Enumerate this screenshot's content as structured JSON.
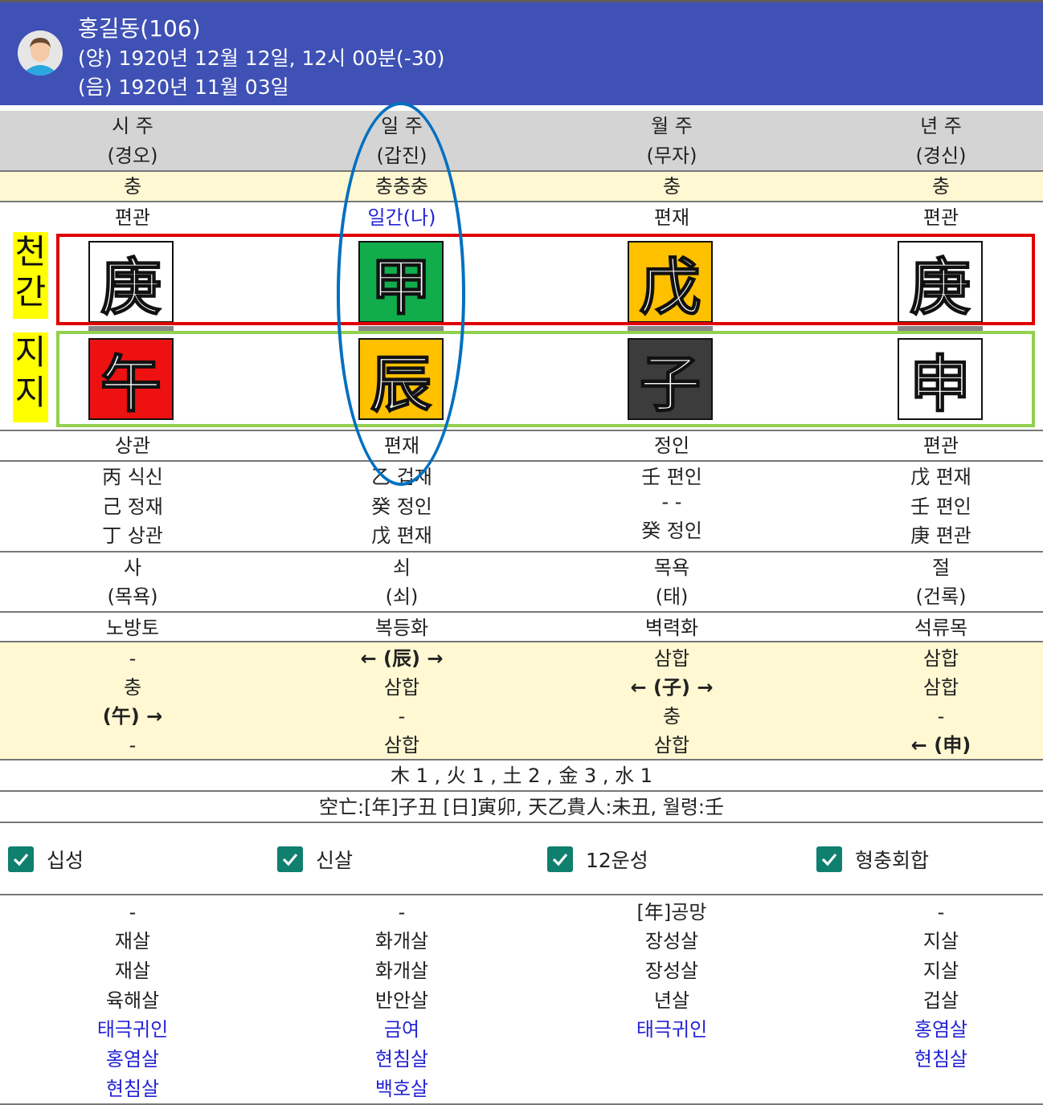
{
  "header": {
    "name": "홍길동(106)",
    "solar": "(양) 1920년 12월 12일, 12시 00분(-30)",
    "lunar": "(음) 1920년 11월 03일"
  },
  "pillars": {
    "titles": [
      "시 주",
      "일 주",
      "월 주",
      "년 주"
    ],
    "subtitles": [
      "(경오)",
      "(갑진)",
      "(무자)",
      "(경신)"
    ],
    "clash": [
      "충",
      "충충충",
      "충",
      "충"
    ],
    "stem_gods": [
      "편관",
      "일간(나)",
      "편재",
      "편관"
    ],
    "stems": [
      "庚",
      "甲",
      "戊",
      "庚"
    ],
    "branches": [
      "午",
      "辰",
      "子",
      "申"
    ],
    "branch_gods": [
      "상관",
      "편재",
      "정인",
      "편관"
    ],
    "hidden": [
      [
        "丙 식신",
        "己 정재",
        "丁 상관"
      ],
      [
        "乙 겁재",
        "癸 정인",
        "戊 편재"
      ],
      [
        "壬 편인",
        "- -",
        "癸 정인"
      ],
      [
        "戊 편재",
        "壬 편인",
        "庚 편관"
      ]
    ],
    "twelve_stage": [
      "사",
      "쇠",
      "목욕",
      "절"
    ],
    "twelve_stage_sub": [
      "(목욕)",
      "(쇠)",
      "(태)",
      "(건록)"
    ],
    "napeum": [
      "노방토",
      "복등화",
      "벽력화",
      "석류목"
    ],
    "relations": [
      [
        "-",
        "충",
        "(午) →",
        "-"
      ],
      [
        "← (辰) →",
        "삼합",
        "-",
        "삼합"
      ],
      [
        "삼합",
        "← (子) →",
        "충",
        "삼합"
      ],
      [
        "삼합",
        "삼합",
        "-",
        "← (申)"
      ]
    ]
  },
  "side_labels": {
    "stem": [
      "천",
      "간"
    ],
    "branch": [
      "지",
      "지"
    ]
  },
  "elements_summary": "木 1 , 火 1 , 土 2 , 金 3 , 水 1",
  "voids_summary": "空亡:[年]子丑 [日]寅卯, 天乙貴人:未丑, 월령:壬",
  "toggles": [
    {
      "label": "십성",
      "checked": true
    },
    {
      "label": "신살",
      "checked": true
    },
    {
      "label": "12운성",
      "checked": true
    },
    {
      "label": "형충회합",
      "checked": true
    }
  ],
  "sinsal": [
    [
      "-",
      "재살",
      "재살",
      "육해살",
      "태극귀인",
      "홍염살",
      "현침살"
    ],
    [
      "-",
      "화개살",
      "화개살",
      "반안살",
      "금여",
      "현침살",
      "백호살"
    ],
    [
      "[年]공망",
      "장성살",
      "장성살",
      "년살",
      "태극귀인"
    ],
    [
      "-",
      "지살",
      "지살",
      "겁살",
      "홍염살",
      "현침살"
    ]
  ],
  "sinsal_blue_from": [
    4,
    4,
    4,
    4
  ],
  "colors": {
    "header_bg": "#3f51b5",
    "stem_colors": [
      "white",
      "green",
      "orange",
      "white"
    ],
    "branch_colors": [
      "red",
      "orange",
      "dark",
      "white"
    ],
    "checkbox": "#0f7f6e",
    "accent_blue": "#2424d6"
  }
}
